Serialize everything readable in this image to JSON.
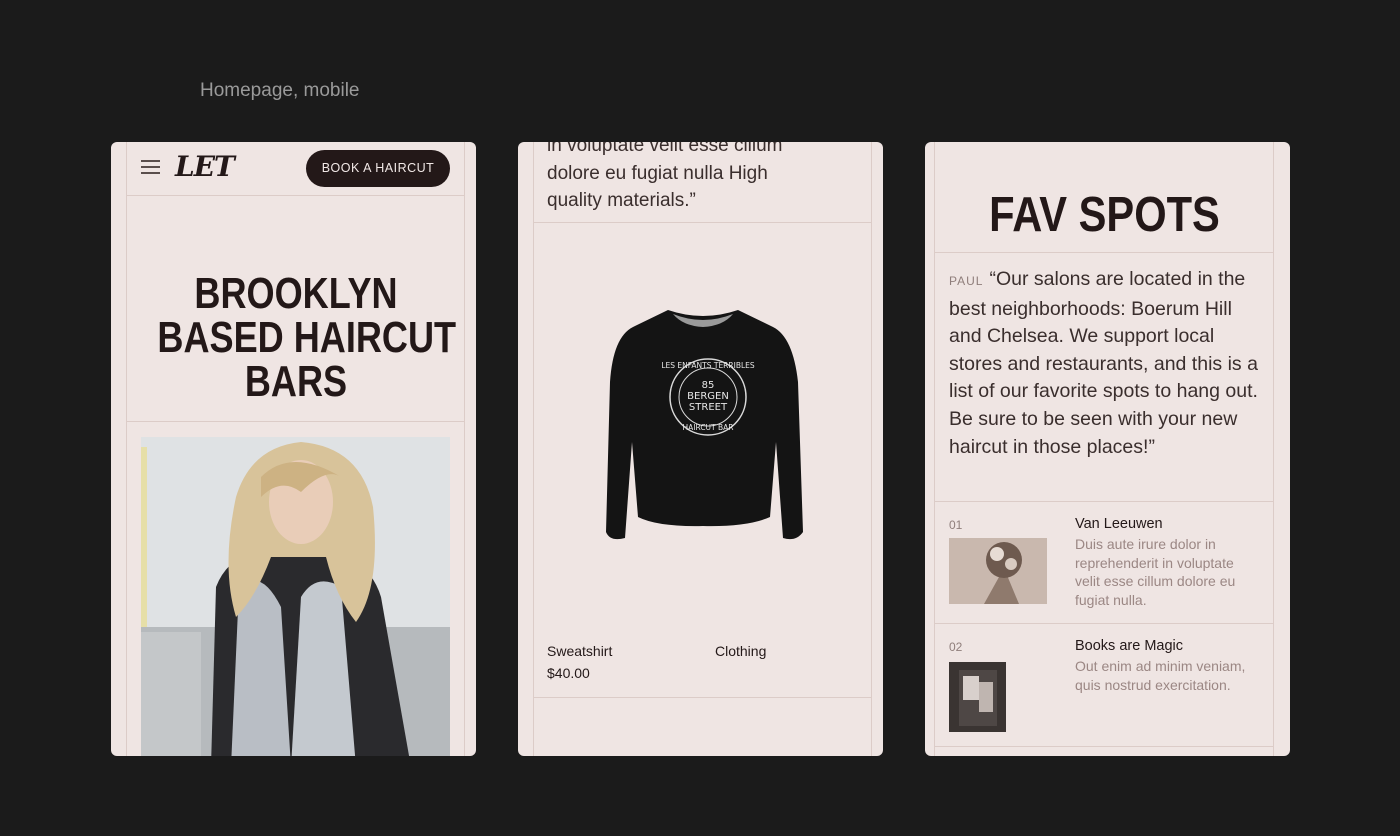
{
  "caption": "Homepage, mobile",
  "phone1": {
    "logo": "LET",
    "cta": "BOOK A HAIRCUT",
    "headline": [
      "BROOKLYN",
      "BASED HAIRCUT",
      "BARS"
    ]
  },
  "phone2": {
    "quote_lines": [
      "in voluptate velit esse cillum",
      "dolore eu fugiat nulla High",
      "quality materials.”"
    ],
    "product": {
      "name": "Sweatshirt",
      "price": "$40.00",
      "category": "Clothing",
      "print_lines": [
        "LES ENFANTS TERRIBLES",
        "85",
        "BERGEN",
        "STREET",
        "HAIRCUT BAR"
      ]
    }
  },
  "phone3": {
    "title": "FAV SPOTS",
    "quote_author": "PAUL",
    "quote": "“Our salons are located in the best neighborhoods: Boerum Hill and Chelsea. We support local stores and restaurants, and this is a list of our favorite spots to hang out. Be sure to be seen with your new haircut in those places!”",
    "spots": [
      {
        "num": "01",
        "name": "Van Leeuwen",
        "desc": "Duis aute irure dolor in reprehenderit in voluptate velit esse cillum dolore eu fugiat nulla."
      },
      {
        "num": "02",
        "name": "Books are Magic",
        "desc": "Out enim ad minim veniam, quis nostrud exercitation."
      }
    ]
  }
}
